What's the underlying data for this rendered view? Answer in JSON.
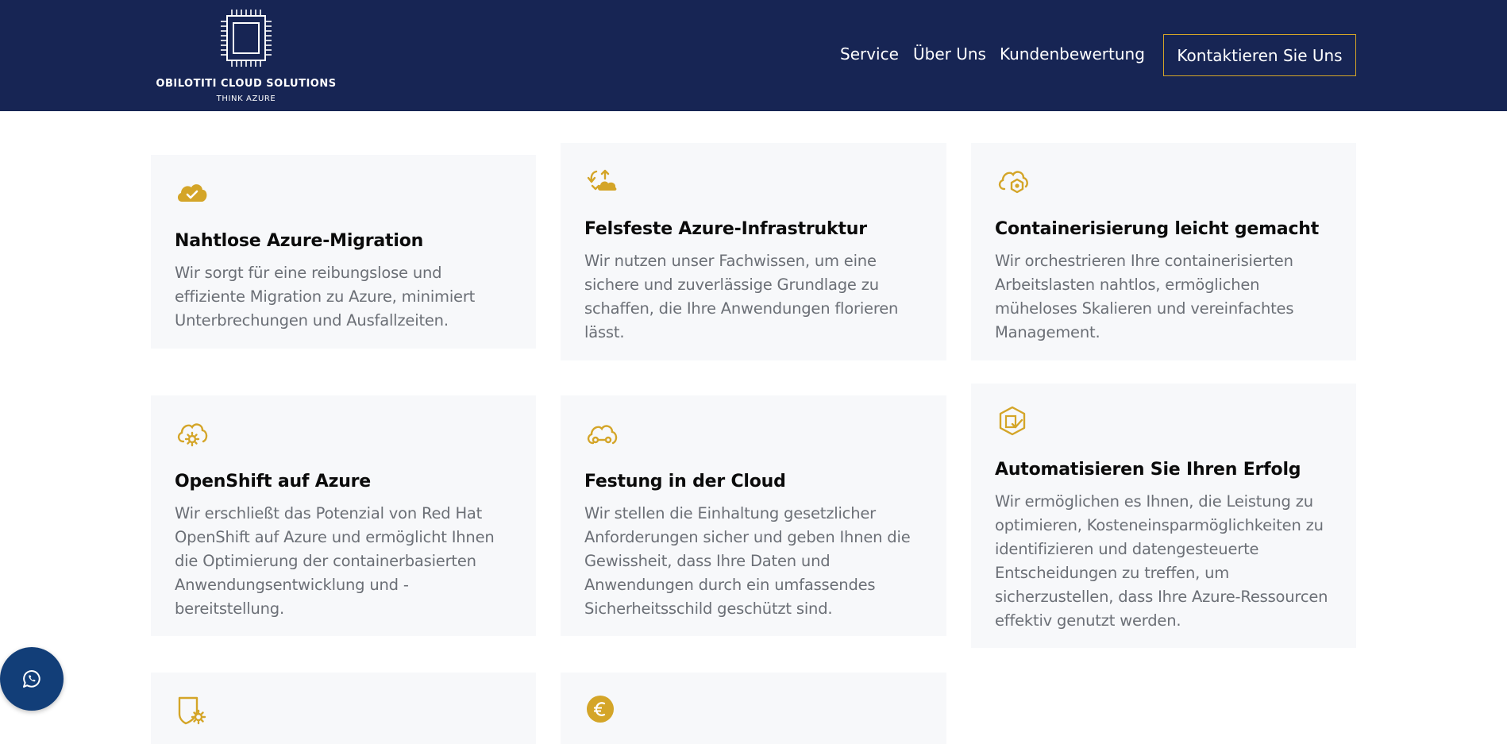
{
  "brand": {
    "name": "OBILOTITI CLOUD SOLUTIONS",
    "tagline": "THINK AZURE",
    "logo_icon": "chip-icon"
  },
  "nav": {
    "items": [
      {
        "label": "Service"
      },
      {
        "label": "Über Uns"
      },
      {
        "label": "Kundenbewertung"
      }
    ],
    "cta": "Kontaktieren Sie Uns"
  },
  "colors": {
    "header_bg": "#172554",
    "accent": "#d4a528",
    "card_bg": "#f7f8fa",
    "whatsapp_bg": "#123e78"
  },
  "services": [
    {
      "icon": "cloud-check-icon",
      "title": "Nahtlose Azure-Migration",
      "text": "Wir sorgt für eine reibungslose und effiziente Migration zu Azure, minimiert Unterbrechungen und Ausfallzeiten."
    },
    {
      "icon": "cloud-sync-icon",
      "title": "Felsfeste Azure-Infrastruktur",
      "text": "Wir nutzen unser Fachwissen, um eine sichere und zuverlässige Grundlage zu schaffen, die Ihre Anwendungen florieren lässt."
    },
    {
      "icon": "cloud-hexagon-icon",
      "title": "Containerisierung leicht gemacht",
      "text": "Wir orchestrieren Ihre containerisierten Arbeitslasten nahtlos, ermöglichen müheloses Skalieren und vereinfachtes Management."
    },
    {
      "icon": "cloud-gear-icon",
      "title": "OpenShift auf Azure",
      "text": "Wir erschließt das Potenzial von Red Hat OpenShift auf Azure und ermöglicht Ihnen die Optimierung der containerbasierten Anwendungsentwicklung und -bereitstellung."
    },
    {
      "icon": "cloud-connection-icon",
      "title": "Festung in der Cloud",
      "text": "Wir stellen die Einhaltung gesetzlicher Anforderungen sicher und geben Ihnen die Gewissheit, dass Ihre Daten und Anwendungen durch ein umfassendes Sicherheitsschild geschützt sind."
    },
    {
      "icon": "hexagon-check-icon",
      "title": "Automatisieren Sie Ihren Erfolg",
      "text": "Wir ermöglichen es Ihnen, die Leistung zu optimieren, Kosteneinsparmöglichkeiten zu identifizieren und datengesteuerte Entscheidungen zu treffen, um sicherzustellen, dass Ihre Azure-Ressourcen effektiv genutzt werden."
    },
    {
      "icon": "shield-gear-icon",
      "title": "",
      "text": ""
    },
    {
      "icon": "euro-coin-icon",
      "title": "",
      "text": ""
    }
  ],
  "whatsapp": {
    "icon": "whatsapp-icon"
  }
}
